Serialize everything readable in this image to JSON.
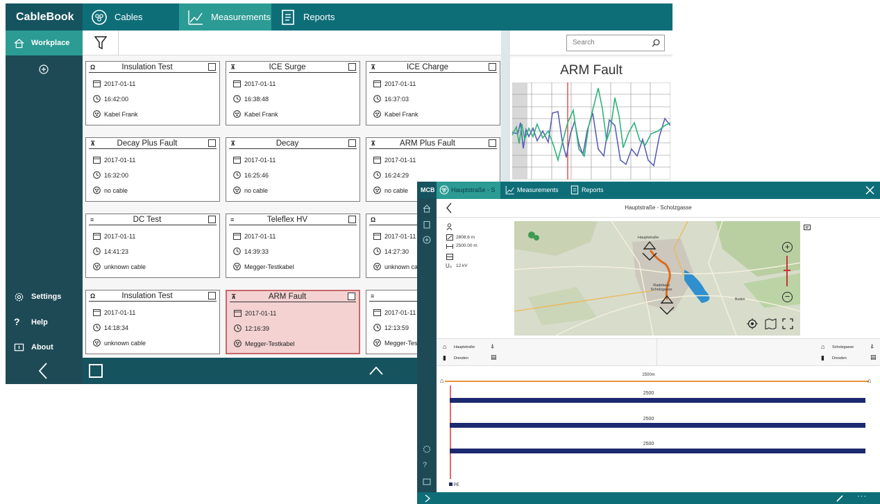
{
  "back": {
    "brand": "CableBook",
    "tabs": [
      {
        "label": "Cables",
        "icon": "cable-icon"
      },
      {
        "label": "Measurements",
        "icon": "chart-line-icon"
      },
      {
        "label": "Reports",
        "icon": "document-icon"
      }
    ],
    "sidebar": {
      "workplace": "Workplace",
      "settings": "Settings",
      "help": "Help",
      "about": "About"
    },
    "search_placeholder": "Search",
    "cards": [
      {
        "title": "Insulation Test",
        "type": "Ω",
        "date": "2017-01-11",
        "time": "16:42:00",
        "cable": "Kabel Frank"
      },
      {
        "title": "ICE Surge",
        "type": "⊼",
        "date": "2017-01-11",
        "time": "16:38:48",
        "cable": "Kabel Frank"
      },
      {
        "title": "ICE Charge",
        "type": "⊼",
        "date": "2017-01-11",
        "time": "16:37:03",
        "cable": "Kabel Frank"
      },
      {
        "title": "Decay Plus Fault",
        "type": "⊼",
        "date": "2017-01-11",
        "time": "16:32:00",
        "cable": "no cable"
      },
      {
        "title": "Decay",
        "type": "⊼",
        "date": "2017-01-11",
        "time": "16:25:46",
        "cable": "no cable"
      },
      {
        "title": "ARM Plus Fault",
        "type": "⊼",
        "date": "2017-01-11",
        "time": "16:24:29",
        "cable": "no cable"
      },
      {
        "title": "DC Test",
        "type": "≡",
        "date": "2017-01-11",
        "time": "14:41:23",
        "cable": "unknown cable"
      },
      {
        "title": "Teleflex HV",
        "type": "≡",
        "date": "2017-01-11",
        "time": "14:39:33",
        "cable": "Megger-Testkabel"
      },
      {
        "title": "Insu",
        "type": "Ω",
        "date": "2017-01-11",
        "time": "14:27:30",
        "cable": "unknown cal"
      },
      {
        "title": "Insulation Test",
        "type": "Ω",
        "date": "2017-01-11",
        "time": "14:18:34",
        "cable": "unknown cable"
      },
      {
        "title": "ARM Fault",
        "type": "⊼",
        "date": "2017-01-11",
        "time": "12:16:39",
        "cable": "Megger-Testkabel"
      },
      {
        "title": "",
        "type": "≡",
        "date": "2017-01-11",
        "time": "12:13:59",
        "cable": "Megger-Tes"
      }
    ],
    "preview_title": "ARM Fault"
  },
  "front": {
    "brand": "MCB",
    "tabs": [
      {
        "label": "Hauptstraße - S",
        "icon": "cable-icon"
      },
      {
        "label": "Measurements",
        "icon": "chart-line-icon"
      },
      {
        "label": "Reports",
        "icon": "document-icon"
      }
    ],
    "header_title": "Hauptstraße - Scholzgasse",
    "info": {
      "length1": "2808.6 m",
      "length2": "2500.00 m",
      "voltage": "12 kV"
    },
    "map_labels": {
      "start": "Hauptstraße",
      "end": "Radebeul Scholzgasse",
      "town": "Boden"
    },
    "start_end": {
      "start_street": "Hauptstraße",
      "start_city": "Dresden",
      "end_street": "Scholzgasse",
      "end_city": "Dresden"
    },
    "route_length": "2500m",
    "lanes": [
      "2500",
      "2500",
      "2500"
    ],
    "legend_pe": "PE"
  }
}
